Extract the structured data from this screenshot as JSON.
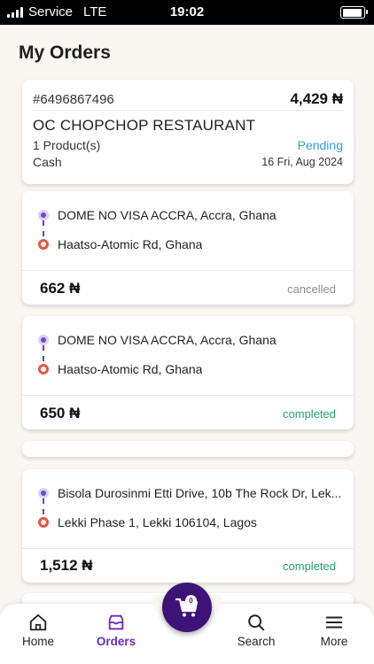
{
  "status_bar": {
    "carrier": "Service",
    "network": "LTE",
    "time": "19:02",
    "battery_level": 0.95
  },
  "page": {
    "title": "My Orders"
  },
  "summary": {
    "order_id": "#6496867496",
    "total": "4,429 ₦",
    "restaurant": "OC CHOPCHOP RESTAURANT",
    "products": "1 Product(s)",
    "status": "Pending",
    "payment": "Cash",
    "date": "16 Fri, Aug 2024"
  },
  "trips": [
    {
      "pickup": "DOME NO VISA ACCRA, Accra, Ghana",
      "dropoff": "Haatso-Atomic Rd, Ghana",
      "price": "662 ₦",
      "status": "cancelled"
    },
    {
      "pickup": "DOME NO VISA ACCRA, Accra, Ghana",
      "dropoff": "Haatso-Atomic Rd, Ghana",
      "price": "650 ₦",
      "status": "completed"
    },
    {
      "pickup": "Bisola Durosinmi Etti Drive, 10b The Rock Dr, Lek...",
      "dropoff": "Lekki Phase 1, Lekki 106104, Lagos",
      "price": "1,512 ₦",
      "status": "completed"
    }
  ],
  "cart": {
    "count": "0",
    "icon": "cart-icon"
  },
  "nav": [
    {
      "label": "Home",
      "icon": "home-icon"
    },
    {
      "label": "Orders",
      "icon": "orders-icon",
      "active": true
    },
    {
      "label": "Search",
      "icon": "search-icon"
    },
    {
      "label": "More",
      "icon": "menu-icon"
    }
  ],
  "colors": {
    "accent": "#6a2bb5",
    "pending": "#2f9fd8",
    "completed": "#22a36b",
    "cancelled": "#8e8e8e",
    "pickup": "#6a4cc5",
    "dropoff": "#e0583d",
    "fab": "#3d1377"
  }
}
